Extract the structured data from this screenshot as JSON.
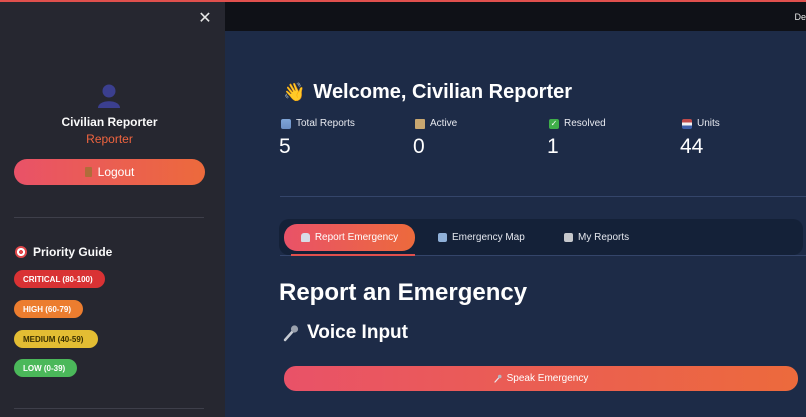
{
  "sidebar": {
    "close_glyph": "✕",
    "profile": {
      "name": "Civilian Reporter",
      "role": "Reporter"
    },
    "logout_label": "Logout",
    "priority_guide": {
      "title": "Priority Guide",
      "levels": [
        {
          "label": "CRITICAL (80-100)",
          "color": "#d93234"
        },
        {
          "label": "HIGH (60-79)",
          "color": "#ec7d2f"
        },
        {
          "label": "MEDIUM (40-59)",
          "color": "#e3bd33"
        },
        {
          "label": "LOW (0-39)",
          "color": "#4bb85a"
        }
      ]
    }
  },
  "topbar": {
    "deploy_label": "De"
  },
  "main": {
    "welcome": {
      "emoji": "👋",
      "text": "Welcome, Civilian Reporter"
    },
    "metrics": [
      {
        "label": "Total Reports",
        "value": "5",
        "icon": "chart-icon"
      },
      {
        "label": "Active",
        "value": "0",
        "icon": "hourglass-icon"
      },
      {
        "label": "Resolved",
        "value": "1",
        "icon": "check-icon"
      },
      {
        "label": "Units",
        "value": "44",
        "icon": "flag-icon"
      }
    ],
    "tabs": [
      {
        "label": "Report Emergency",
        "icon": "siren-icon",
        "active": true
      },
      {
        "label": "Emergency Map",
        "icon": "map-icon",
        "active": false
      },
      {
        "label": "My Reports",
        "icon": "clipboard-icon",
        "active": false
      }
    ],
    "section_title": "Report an Emergency",
    "voice_title": "Voice Input",
    "speak_button_label": "Speak Emergency"
  },
  "colors": {
    "accent_start": "#e95268",
    "accent_end": "#ec6a3c",
    "sidebar_bg": "#262730",
    "main_bg": "#1d2b47"
  }
}
